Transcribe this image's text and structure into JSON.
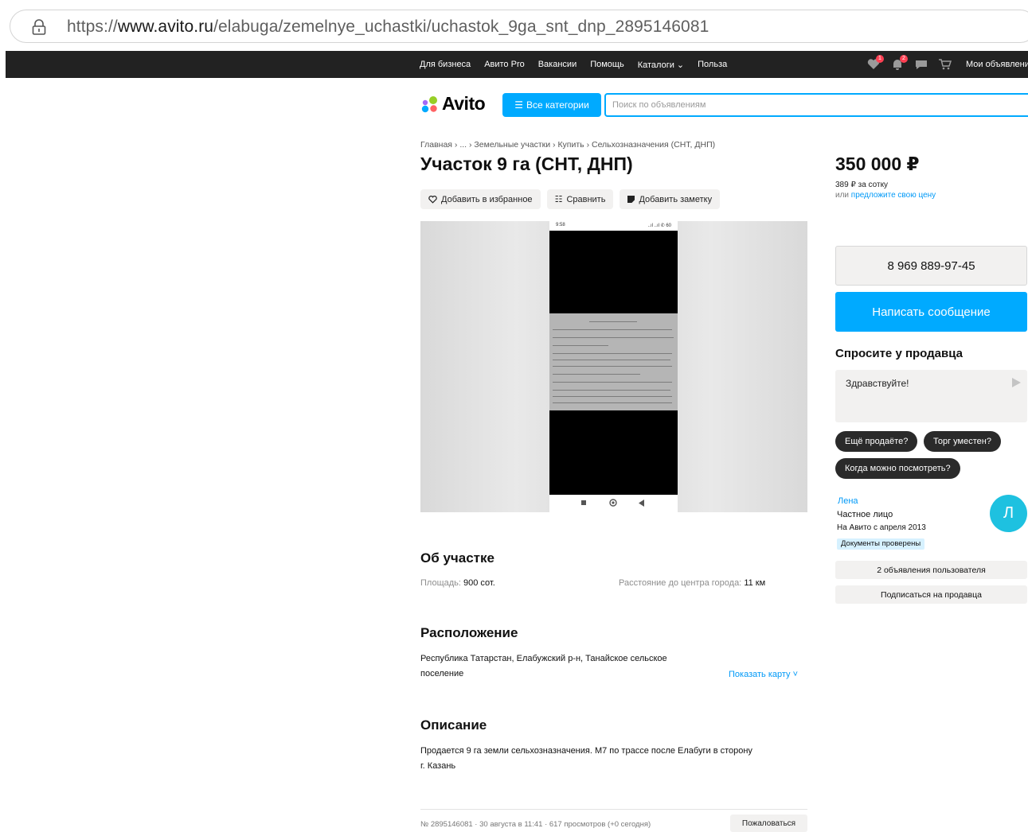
{
  "browser": {
    "url_prefix": "https://",
    "url_host": "www.avito.ru",
    "url_path": "/elabuga/zemelnye_uchastki/uchastok_9ga_snt_dnp_2895146081"
  },
  "topnav": {
    "links": [
      "Для бизнеса",
      "Авито Pro",
      "Вакансии",
      "Помощь",
      "Каталоги",
      "Польза"
    ],
    "favorites_badge": "1",
    "notifications_badge": "2",
    "my_ads": "Мои объявления"
  },
  "header": {
    "logo_text": "Avito",
    "categories_label": "Все категории",
    "search_placeholder": "Поиск по объявлениям"
  },
  "breadcrumbs": [
    "Главная",
    "...",
    "Земельные участки",
    "Купить",
    "Сельхозназначения (СНТ, ДНП)"
  ],
  "listing": {
    "title": "Участок 9 га (СНТ, ДНП)",
    "actions": {
      "favorite": "Добавить в избранное",
      "compare": "Сравнить",
      "note": "Добавить заметку"
    },
    "gallery": {
      "phone_time": "9:58",
      "phone_signal": "..ıl ..ıl ✆ 60"
    }
  },
  "price": {
    "value": "350 000 ₽",
    "per_sotka": "389 ₽ за сотку",
    "or_label": "или",
    "offer_link": "предложите свою цену"
  },
  "contact": {
    "phone": "8 969 889-97-45",
    "message_button": "Написать сообщение",
    "ask_title": "Спросите у продавца",
    "ask_text": "Здравствуйте!",
    "chips": [
      "Ещё продаёте?",
      "Торг уместен?",
      "Когда можно посмотреть?"
    ]
  },
  "seller": {
    "name": "Лена",
    "type": "Частное лицо",
    "since": "На Авито с апреля 2013",
    "verified": "Документы проверены",
    "avatar_letter": "Л",
    "ads_button": "2 объявления пользователя",
    "subscribe_button": "Подписаться на продавца"
  },
  "about": {
    "title": "Об участке",
    "area_label": "Площадь:",
    "area_value": "900 сот.",
    "distance_label": "Расстояние до центра города:",
    "distance_value": "11 км"
  },
  "location": {
    "title": "Расположение",
    "address_line1": "Республика Татарстан, Елабужский р-н, Танайское сельское",
    "address_line2": "поселение",
    "show_map": "Показать карту"
  },
  "description": {
    "title": "Описание",
    "line1": "Продается 9 га земли сельхозназначения. М7 по трассе после Елабуги в сторону",
    "line2": "г. Казань"
  },
  "footer": {
    "meta": "№ 2895146081 · 30 августа в 11:41 · 617 просмотров (+0 сегодня)",
    "report": "Пожаловаться"
  },
  "colors": {
    "accent": "#00aaff",
    "link": "#0099f7",
    "dark_nav": "#222222",
    "avatar": "#1ec1e0"
  }
}
